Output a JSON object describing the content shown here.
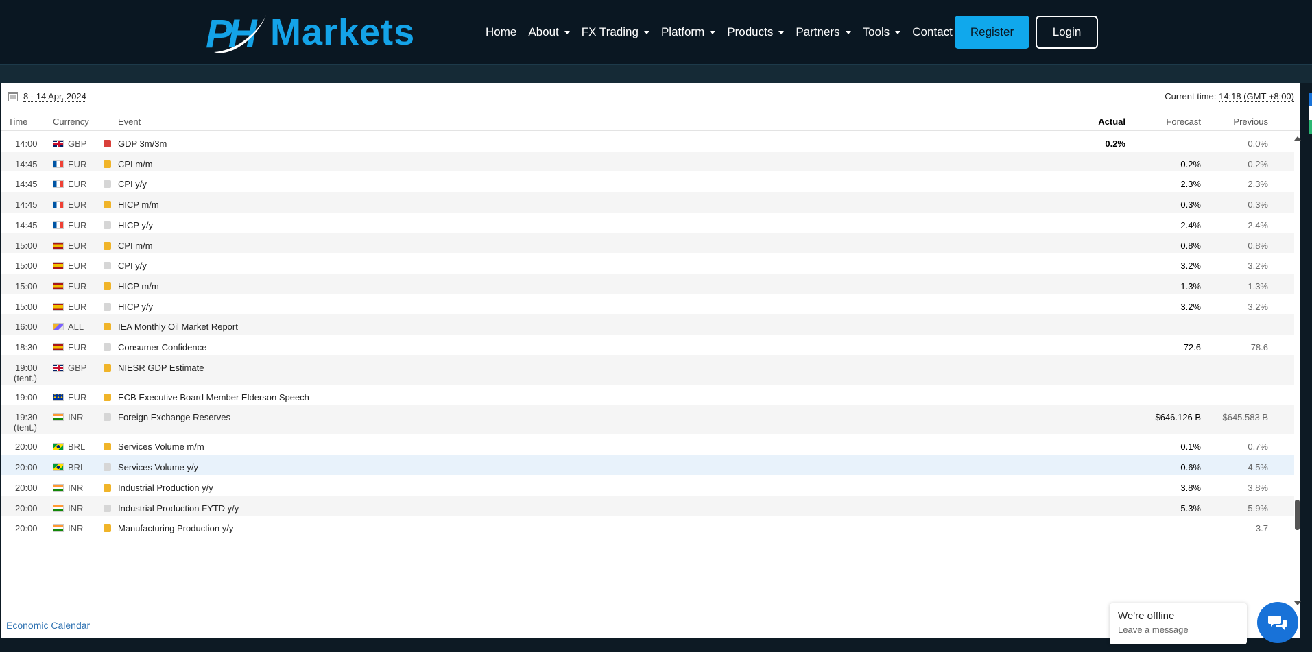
{
  "header": {
    "logo_mark": "PH",
    "logo_text": "Markets",
    "nav": [
      {
        "label": "Home",
        "dropdown": false
      },
      {
        "label": "About",
        "dropdown": true
      },
      {
        "label": "FX Trading",
        "dropdown": true
      },
      {
        "label": "Platform",
        "dropdown": true
      },
      {
        "label": "Products",
        "dropdown": true
      },
      {
        "label": "Partners",
        "dropdown": true
      },
      {
        "label": "Tools",
        "dropdown": true
      },
      {
        "label": "Contact",
        "dropdown": false
      }
    ],
    "register_label": "Register",
    "login_label": "Login"
  },
  "calendar": {
    "date_range": "8 - 14 Apr, 2024",
    "current_time_label": "Current time:",
    "current_time_value": "14:18 (GMT +8:00)",
    "columns": {
      "time": "Time",
      "currency": "Currency",
      "event": "Event",
      "actual": "Actual",
      "forecast": "Forecast",
      "previous": "Previous"
    },
    "rows": [
      {
        "time": "14:00",
        "tent": "",
        "flag": "gb",
        "currency": "GBP",
        "importance": "high",
        "event": "GDP 3m/3m",
        "actual": "0.2%",
        "forecast": "",
        "previous": "0.0%",
        "previous_dotted": true
      },
      {
        "time": "14:45",
        "tent": "",
        "flag": "fr",
        "currency": "EUR",
        "importance": "medium",
        "event": "CPI m/m",
        "actual": "",
        "forecast": "0.2%",
        "previous": "0.2%"
      },
      {
        "time": "14:45",
        "tent": "",
        "flag": "fr",
        "currency": "EUR",
        "importance": "low",
        "event": "CPI y/y",
        "actual": "",
        "forecast": "2.3%",
        "previous": "2.3%"
      },
      {
        "time": "14:45",
        "tent": "",
        "flag": "fr",
        "currency": "EUR",
        "importance": "medium",
        "event": "HICP m/m",
        "actual": "",
        "forecast": "0.3%",
        "previous": "0.3%"
      },
      {
        "time": "14:45",
        "tent": "",
        "flag": "fr",
        "currency": "EUR",
        "importance": "low",
        "event": "HICP y/y",
        "actual": "",
        "forecast": "2.4%",
        "previous": "2.4%"
      },
      {
        "time": "15:00",
        "tent": "",
        "flag": "es",
        "currency": "EUR",
        "importance": "medium",
        "event": "CPI m/m",
        "actual": "",
        "forecast": "0.8%",
        "previous": "0.8%"
      },
      {
        "time": "15:00",
        "tent": "",
        "flag": "es",
        "currency": "EUR",
        "importance": "low",
        "event": "CPI y/y",
        "actual": "",
        "forecast": "3.2%",
        "previous": "3.2%"
      },
      {
        "time": "15:00",
        "tent": "",
        "flag": "es",
        "currency": "EUR",
        "importance": "medium",
        "event": "HICP m/m",
        "actual": "",
        "forecast": "1.3%",
        "previous": "1.3%"
      },
      {
        "time": "15:00",
        "tent": "",
        "flag": "es",
        "currency": "EUR",
        "importance": "low",
        "event": "HICP y/y",
        "actual": "",
        "forecast": "3.2%",
        "previous": "3.2%"
      },
      {
        "time": "16:00",
        "tent": "",
        "flag": "all",
        "currency": "ALL",
        "importance": "medium",
        "event": "IEA Monthly Oil Market Report",
        "actual": "",
        "forecast": "",
        "previous": ""
      },
      {
        "time": "18:30",
        "tent": "",
        "flag": "es",
        "currency": "EUR",
        "importance": "low",
        "event": "Consumer Confidence",
        "actual": "",
        "forecast": "72.6",
        "previous": "78.6"
      },
      {
        "time": "19:00",
        "tent": "(tent.)",
        "flag": "gb",
        "currency": "GBP",
        "importance": "medium",
        "event": "NIESR GDP Estimate",
        "actual": "",
        "forecast": "",
        "previous": ""
      },
      {
        "time": "19:00",
        "tent": "",
        "flag": "eu",
        "currency": "EUR",
        "importance": "medium",
        "event": "ECB Executive Board Member Elderson Speech",
        "actual": "",
        "forecast": "",
        "previous": ""
      },
      {
        "time": "19:30",
        "tent": "(tent.)",
        "flag": "in",
        "currency": "INR",
        "importance": "low",
        "event": "Foreign Exchange Reserves",
        "actual": "",
        "forecast": "$646.126 B",
        "previous": "$645.583 B"
      },
      {
        "time": "20:00",
        "tent": "",
        "flag": "br",
        "currency": "BRL",
        "importance": "medium",
        "event": "Services Volume m/m",
        "actual": "",
        "forecast": "0.1%",
        "previous": "0.7%"
      },
      {
        "time": "20:00",
        "tent": "",
        "flag": "br",
        "currency": "BRL",
        "importance": "low",
        "event": "Services Volume y/y",
        "actual": "",
        "forecast": "0.6%",
        "previous": "4.5%"
      },
      {
        "time": "20:00",
        "tent": "",
        "flag": "in",
        "currency": "INR",
        "importance": "medium",
        "event": "Industrial Production y/y",
        "actual": "",
        "forecast": "3.8%",
        "previous": "3.8%"
      },
      {
        "time": "20:00",
        "tent": "",
        "flag": "in",
        "currency": "INR",
        "importance": "low",
        "event": "Industrial Production FYTD y/y",
        "actual": "",
        "forecast": "5.3%",
        "previous": "5.9%"
      },
      {
        "time": "20:00",
        "tent": "",
        "flag": "in",
        "currency": "INR",
        "importance": "medium",
        "event": "Manufacturing Production y/y",
        "actual": "",
        "forecast": "",
        "previous": "3.7"
      }
    ],
    "highlighted_row": 15,
    "footer_link": "Economic Calendar"
  },
  "chat": {
    "title": "We're offline",
    "subtitle": "Leave a message"
  },
  "colors": {
    "brand": "#14a3e8",
    "header_bg": "#0a1722",
    "importance_high": "#d9403a",
    "importance_medium": "#f0b429",
    "importance_low": "#d6d6d6",
    "chat_button": "#1872d8"
  },
  "icons": {
    "calendar": "calendar-icon",
    "dropdown": "chevron-down-icon",
    "chat": "chat-bubbles-icon",
    "scroll_up": "scroll-up-arrow-icon",
    "scroll_down": "scroll-down-arrow-icon"
  }
}
